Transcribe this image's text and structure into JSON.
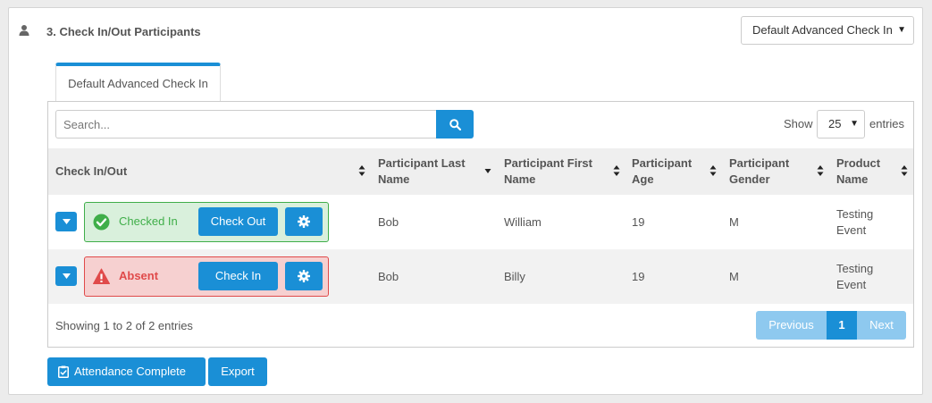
{
  "section": {
    "title": "3. Check In/Out Participants",
    "icon": "user-icon"
  },
  "mode_select": {
    "value": "Default Advanced Check In"
  },
  "tab": {
    "label": "Default Advanced Check In"
  },
  "search": {
    "placeholder": "Search...",
    "value": ""
  },
  "length": {
    "show_label": "Show",
    "value": "25",
    "entries_label": "entries"
  },
  "columns": [
    "Check In/Out",
    "Participant Last Name",
    "Participant First Name",
    "Participant Age",
    "Participant Gender",
    "Product Name"
  ],
  "rows": [
    {
      "status": "Checked In",
      "status_icon": "check-circle-icon",
      "action": "Check Out",
      "last_name": "Bob",
      "first_name": "William",
      "age": "19",
      "gender": "M",
      "product": "Testing Event"
    },
    {
      "status": "Absent",
      "status_icon": "warning-icon",
      "action": "Check In",
      "last_name": "Bob",
      "first_name": "Billy",
      "age": "19",
      "gender": "M",
      "product": "Testing Event"
    }
  ],
  "info": "Showing 1 to 2 of 2 entries",
  "pagination": {
    "previous": "Previous",
    "current": "1",
    "next": "Next"
  },
  "footer": {
    "attendance_label": "Attendance Complete",
    "export_label": "Export"
  },
  "colors": {
    "primary": "#1a8fd6",
    "primary_disabled": "#8ec9ef",
    "success": "#3fae49",
    "success_bg": "#d9f0dc",
    "danger": "#e04a4a",
    "danger_bg": "#f6d0d0"
  }
}
